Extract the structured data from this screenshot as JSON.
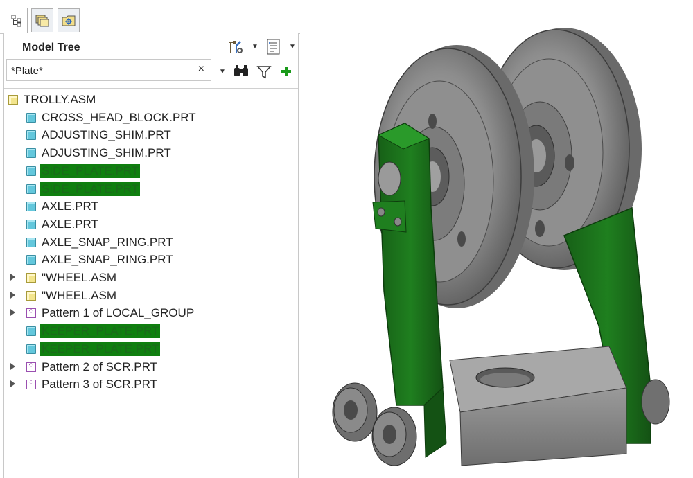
{
  "tabs": [
    {
      "icon": "model-tree-tab-icon"
    },
    {
      "icon": "folder-browser-tab-icon"
    },
    {
      "icon": "favorites-tab-icon"
    }
  ],
  "panel": {
    "title": "Model Tree",
    "tools_icon": "settings-tools-icon",
    "show_icon": "show-list-icon"
  },
  "search": {
    "value": "*Plate*",
    "clear_label": "×"
  },
  "filter_tools": [
    "find-binoculars-icon",
    "filter-funnel-icon",
    "add-plus-icon"
  ],
  "tree": {
    "root": "TROLLY.ASM",
    "items": [
      {
        "label": "CROSS_HEAD_BLOCK.PRT",
        "type": "part"
      },
      {
        "label": "ADJUSTING_SHIM.PRT",
        "type": "part"
      },
      {
        "label": "ADJUSTING_SHIM.PRT",
        "type": "part"
      },
      {
        "label": "SIDE_PLATE.PRT",
        "type": "part",
        "highlighted": true
      },
      {
        "label": "SIDE_PLATE.PRT",
        "type": "part",
        "highlighted": true
      },
      {
        "label": "AXLE.PRT",
        "type": "part"
      },
      {
        "label": "AXLE.PRT",
        "type": "part"
      },
      {
        "label": "AXLE_SNAP_RING.PRT",
        "type": "part"
      },
      {
        "label": "AXLE_SNAP_RING.PRT",
        "type": "part"
      },
      {
        "label": "\"WHEEL.ASM",
        "type": "asm",
        "expandable": true
      },
      {
        "label": "\"WHEEL.ASM",
        "type": "asm",
        "expandable": true
      },
      {
        "label": "Pattern 1 of LOCAL_GROUP",
        "type": "pattern",
        "expandable": true
      },
      {
        "label": "KEEPER_PLATE.PRT",
        "type": "part",
        "highlighted": true
      },
      {
        "label": "KEEPER_PLATE.PRT",
        "type": "part",
        "highlighted": true
      },
      {
        "label": "Pattern 2 of SCR.PRT",
        "type": "pattern",
        "expandable": true
      },
      {
        "label": "Pattern 3 of SCR.PRT",
        "type": "pattern",
        "expandable": true
      }
    ]
  },
  "colors": {
    "highlight": "#0f7f0f",
    "plate_green": "#1e7a1e",
    "metal_gray": "#8a8a8a"
  }
}
